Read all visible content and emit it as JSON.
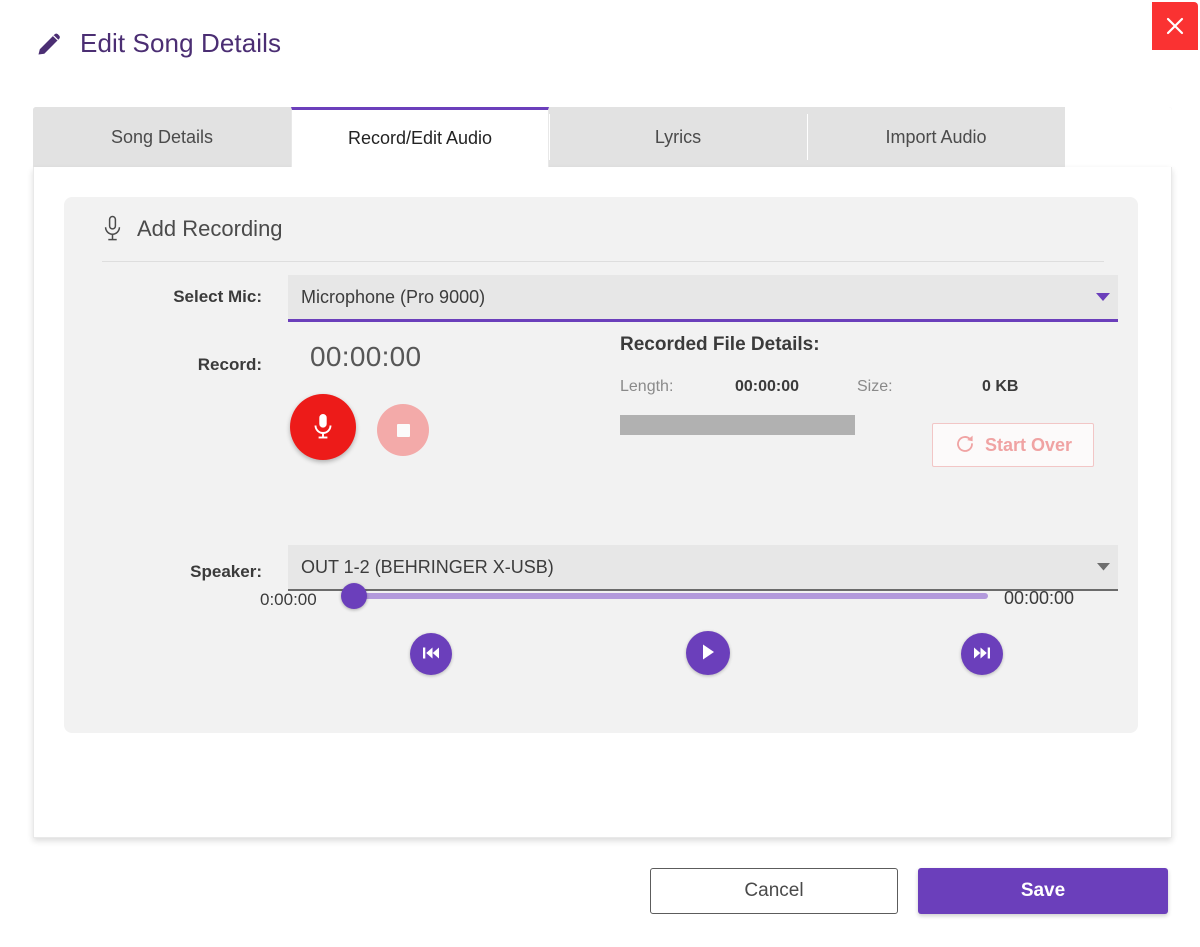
{
  "window": {
    "title": "Edit Song Details",
    "title_icon": "pencil-icon",
    "close_label": "×",
    "accent_color": "#6b3fbb",
    "title_color": "#4b2e73",
    "close_color": "#fa3232"
  },
  "tabs": [
    {
      "label": "Song Details",
      "active": false
    },
    {
      "label": "Record/Edit Audio",
      "active": true
    },
    {
      "label": "Lyrics",
      "active": false
    },
    {
      "label": "Import Audio",
      "active": false
    }
  ],
  "panel": {
    "icon": "microphone-icon",
    "title": "Add Recording"
  },
  "select_mic": {
    "label": "Select Mic:",
    "value": "Microphone (Pro 9000)",
    "caret_icon": "chevron-down-icon",
    "underline_color": "#6b3fbb"
  },
  "record": {
    "label": "Record:",
    "timer": "00:00:00",
    "record_icon": "microphone-icon",
    "stop_icon": "stop-square-icon"
  },
  "recorded_file_details": {
    "title": "Recorded File Details:",
    "length_label": "Length:",
    "length_value": "00:00:00",
    "size_label": "Size:",
    "size_value": "0 KB",
    "progress_percent": 0,
    "start_over_label": "Start Over",
    "start_over_icon": "refresh-icon",
    "start_over_color": "#f0a3a3"
  },
  "speaker": {
    "label": "Speaker:",
    "value": "OUT 1-2 (BEHRINGER X-USB)",
    "caret_icon": "chevron-down-icon",
    "underline_color": "#6b6b6b"
  },
  "playback": {
    "current_time": "0:00:00",
    "total_time": "00:00:00",
    "slider_value_percent": 0,
    "prev_icon": "skip-previous-icon",
    "play_icon": "play-icon",
    "next_icon": "skip-next-icon"
  },
  "footer": {
    "cancel_label": "Cancel",
    "save_label": "Save"
  }
}
